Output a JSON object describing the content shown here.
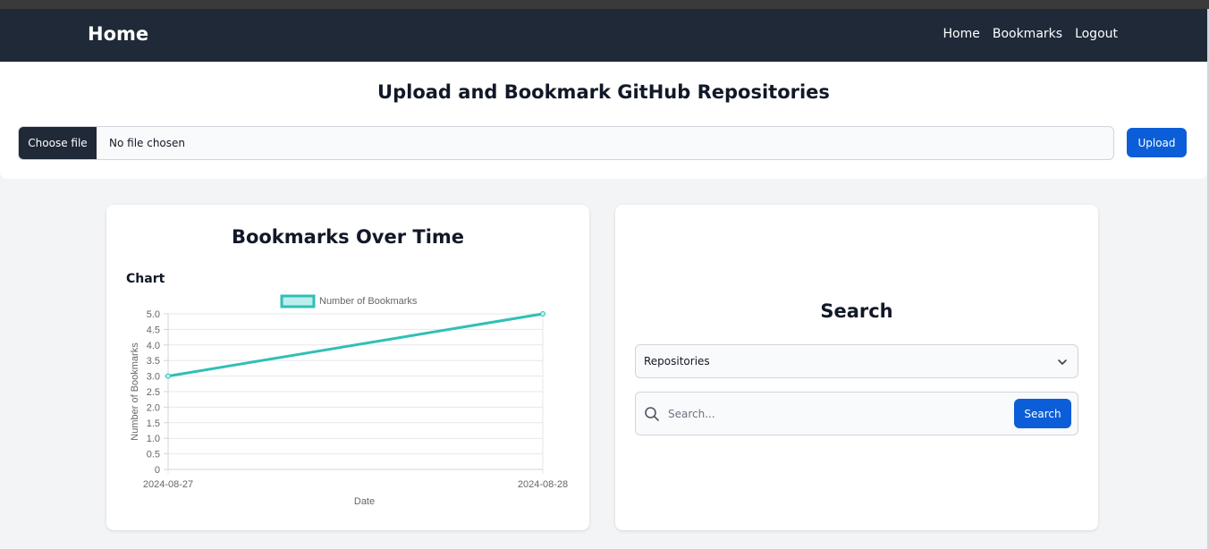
{
  "navbar": {
    "brand": "Home",
    "links": [
      "Home",
      "Bookmarks",
      "Logout"
    ]
  },
  "upload": {
    "title": "Upload and Bookmark GitHub Repositories",
    "choose_file_label": "Choose file",
    "file_status": "No file chosen",
    "upload_button": "Upload"
  },
  "chart_card": {
    "title": "Bookmarks Over Time",
    "subtitle": "Chart"
  },
  "chart_data": {
    "type": "line",
    "x": [
      "2024-08-27",
      "2024-08-28"
    ],
    "series": [
      {
        "name": "Number of Bookmarks",
        "values": [
          3,
          5
        ],
        "color": "#2fbfb7"
      }
    ],
    "xlabel": "Date",
    "ylabel": "Number of Bookmarks",
    "ylim": [
      0,
      5
    ],
    "yticks": [
      "0",
      "0.5",
      "1.0",
      "1.5",
      "2.0",
      "2.5",
      "3.0",
      "3.5",
      "4.0",
      "4.5",
      "5.0"
    ],
    "grid": true,
    "legend": "top"
  },
  "search_card": {
    "title": "Search",
    "select_value": "Repositories",
    "search_placeholder": "Search...",
    "search_button": "Search"
  },
  "colors": {
    "navbar": "#1f2937",
    "primary": "#0b5ed7",
    "series": "#2fbfb7"
  },
  "icons": {
    "search": "magnifier-icon",
    "select": "chevron-down-icon"
  }
}
